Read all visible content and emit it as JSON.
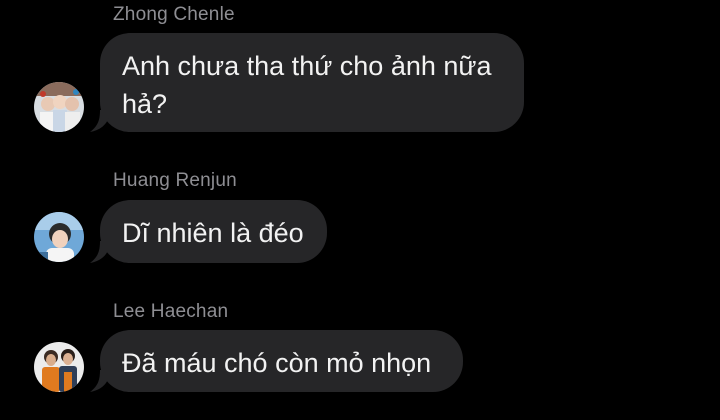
{
  "messages": [
    {
      "sender": "Zhong Chenle",
      "text": "Anh chưa tha thứ cho ảnh nữa hả?",
      "avatar_icon": "group-photo-avatar"
    },
    {
      "sender": "Huang Renjun",
      "text": "Dĩ nhiên là đéo",
      "avatar_icon": "person-photo-avatar"
    },
    {
      "sender": "Lee Haechan",
      "text": "Đã máu chó còn mỏ nhọn",
      "avatar_icon": "two-people-photo-avatar"
    }
  ],
  "colors": {
    "background": "#000000",
    "bubble": "#262628",
    "bubble_text": "#f2f2f2",
    "sender_text": "#8e8e93"
  }
}
